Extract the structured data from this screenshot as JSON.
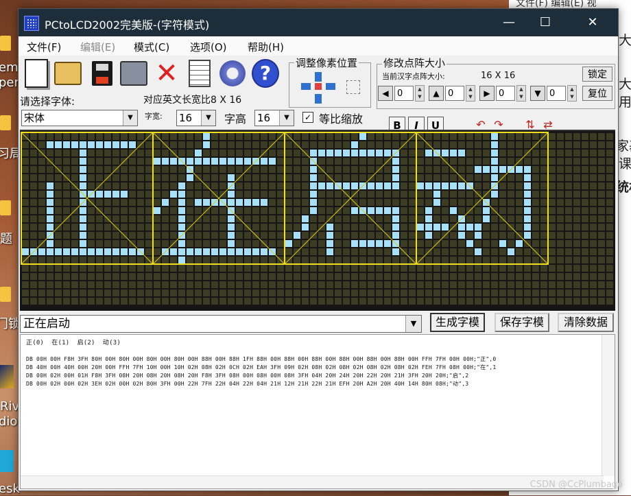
{
  "desktop": {
    "left_labels": [
      "emi",
      "per",
      "习局",
      "题",
      "门锁",
      "Riv",
      "dio",
      "esk"
    ],
    "right_doc": {
      "top_menu": "文件(F)  编辑(E)  视",
      "lines": [
        "大",
        "大",
        "用",
        "家基",
        "课",
        "统机"
      ]
    },
    "watermark": "CSDN @CcPlumbago"
  },
  "window": {
    "title": "PCtoLCD2002完美版-(字符模式)",
    "controls": {
      "minimize": "—",
      "maximize": "☐",
      "close": "✕"
    },
    "menu": [
      {
        "label": "文件(F)",
        "disabled": false
      },
      {
        "label": "编辑(E)",
        "disabled": true
      },
      {
        "label": "模式(C)",
        "disabled": false
      },
      {
        "label": "选项(O)",
        "disabled": false
      },
      {
        "label": "帮助(H)",
        "disabled": false
      }
    ],
    "pixel_adjust_label": "调整像素位置",
    "resize_group": {
      "label": "修改点阵大小",
      "current_size_label": "当前汉字点阵大小:",
      "current_size_value": "16 X 16",
      "lock_button": "锁定",
      "restore_button": "复位",
      "spinners": [
        "0",
        "0",
        "0",
        "0"
      ]
    },
    "font_select_label": "请选择字体:",
    "font_value": "宋体",
    "ratio_label": "对应英文长宽比8 X 16",
    "width_label": "字宽:",
    "width_value": "16",
    "height_label": "字高",
    "height_value": "16",
    "proportional_label": "等比缩放",
    "proportional_checked": "✓",
    "format_buttons": {
      "bold": "B",
      "italic": "I",
      "underline": "U"
    },
    "input_text": "正在启动",
    "buttons": {
      "generate": "生成字模",
      "save": "保存字模",
      "clear": "清除数据"
    },
    "output_header": "正(0)  在(1)  启(2)  动(3)",
    "output_lines": [
      "DB 00H 00H F8H 3FH 80H 00H 80H 00H 80H 00H 80H 00H 88H 00H 88H 1FH 88H 00H 88H 00H 88H 00H 88H 00H 88H 00H 88H 00H FFH 7FH 00H 00H;\"正\",0",
      "DB 40H 00H 40H 00H 20H 00H FFH 7FH 10H 00H 10H 02H 08H 02H 0CH 02H EAH 3FH 09H 02H 08H 02H 08H 02H 08H 02H 08H 02H FEH 7FH 08H 00H;\"在\",1",
      "DB 00H 02H 00H 01H F8H 3FH 08H 20H 08H 20H 08H 20H F8H 3FH 08H 00H 08H 00H 08H 3FH 04H 20H 24H 20H 22H 20H 21H 3FH 20H 20H;\"启\",2",
      "DB 00H 02H 00H 02H 3EH 02H 00H 02H 80H 3FH 00H 22H 7FH 22H 04H 22H 04H 21H 12H 21H 22H 21H EFH 20H A2H 20H 40H 14H 80H 08H;\"动\",3"
    ]
  }
}
